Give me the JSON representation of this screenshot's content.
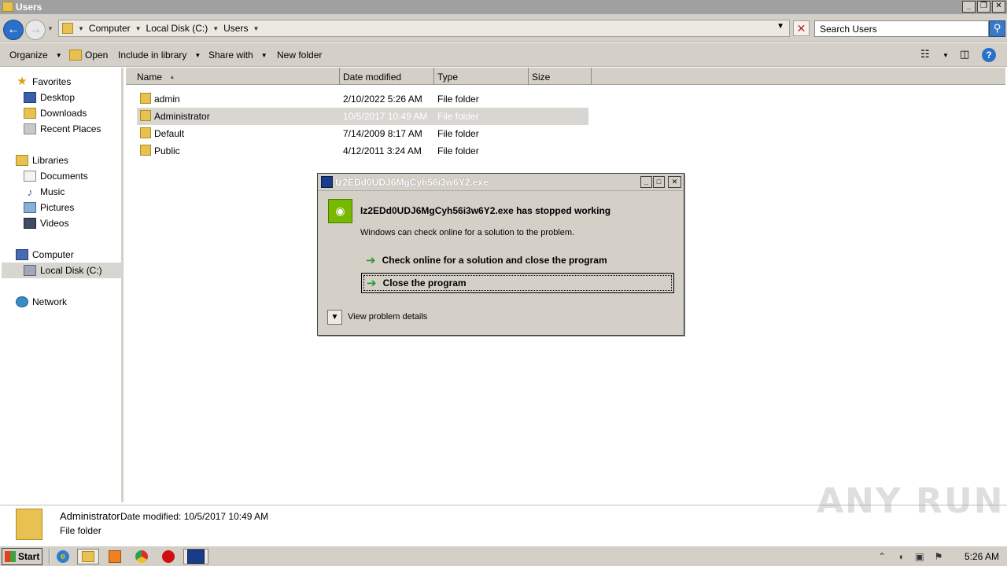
{
  "window": {
    "title": "Users"
  },
  "address_bar": {
    "crumbs": [
      "Computer",
      "Local Disk (C:)",
      "Users"
    ],
    "search_placeholder": "Search Users"
  },
  "toolbar": {
    "organize": "Organize",
    "open": "Open",
    "include_in_library": "Include in library",
    "share_with": "Share with",
    "new_folder": "New folder"
  },
  "nav": {
    "favorites": "Favorites",
    "desktop": "Desktop",
    "downloads": "Downloads",
    "recent_places": "Recent Places",
    "libraries": "Libraries",
    "documents": "Documents",
    "music": "Music",
    "pictures": "Pictures",
    "videos": "Videos",
    "computer": "Computer",
    "local_disk": "Local Disk (C:)",
    "network": "Network"
  },
  "columns": {
    "name": "Name",
    "date_modified": "Date modified",
    "type": "Type",
    "size": "Size"
  },
  "files": [
    {
      "name": "admin",
      "date": "2/10/2022 5:26 AM",
      "type": "File folder"
    },
    {
      "name": "Administrator",
      "date": "10/5/2017 10:49 AM",
      "type": "File folder"
    },
    {
      "name": "Default",
      "date": "7/14/2009 8:17 AM",
      "type": "File folder"
    },
    {
      "name": "Public",
      "date": "4/12/2011 3:24 AM",
      "type": "File folder"
    }
  ],
  "details_pane": {
    "name": "Administrator",
    "meta": "Date modified: 10/5/2017 10:49 AM",
    "type": "File folder"
  },
  "dialog": {
    "title": "Iz2EDd0UDJ6MgCyh56i3w6Y2.exe",
    "heading": "Iz2EDd0UDJ6MgCyh56i3w6Y2.exe has stopped working",
    "subtext": "Windows can check online for a solution to the problem.",
    "option_check_online": "Check online for a solution and close the program",
    "option_close": "Close the program",
    "view_details": "View problem details"
  },
  "taskbar": {
    "start": "Start",
    "clock": "5:26 AM"
  },
  "watermark": "ANY RUN",
  "colors": {
    "nvidia_green": "#76b900",
    "selection_gray": "#d8d6d0",
    "chrome_gray": "#d4d0c8"
  }
}
